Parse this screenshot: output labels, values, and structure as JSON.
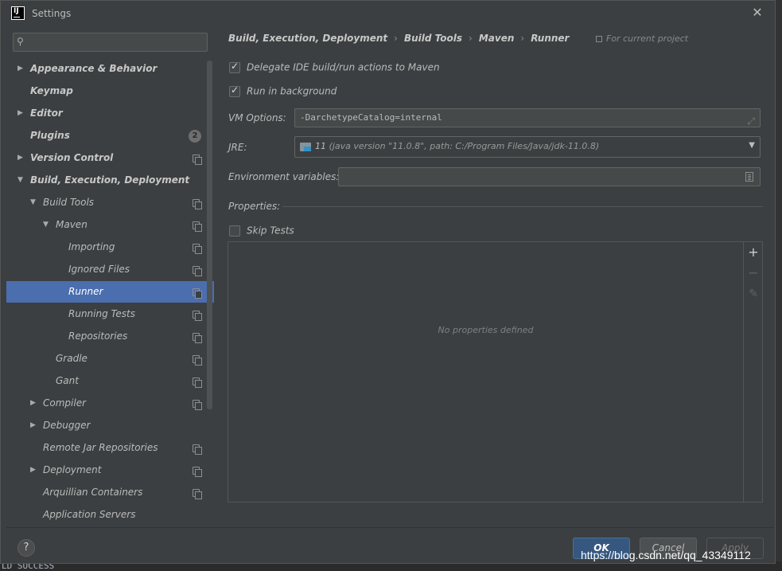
{
  "window": {
    "title": "Settings",
    "app_icon_text": "IJ"
  },
  "search": {
    "placeholder": ""
  },
  "tree": [
    {
      "label": "Appearance & Behavior",
      "bold": true,
      "arrow": "▶",
      "level": 0
    },
    {
      "label": "Keymap",
      "bold": true,
      "arrow": "",
      "level": 0
    },
    {
      "label": "Editor",
      "bold": true,
      "arrow": "▶",
      "level": 0
    },
    {
      "label": "Plugins",
      "bold": true,
      "arrow": "",
      "level": 0,
      "badge": "2"
    },
    {
      "label": "Version Control",
      "bold": true,
      "arrow": "▶",
      "level": 0,
      "copy": true
    },
    {
      "label": "Build, Execution, Deployment",
      "bold": true,
      "arrow": "▼",
      "level": 0
    },
    {
      "label": "Build Tools",
      "bold": false,
      "arrow": "▼",
      "level": 1,
      "copy": true
    },
    {
      "label": "Maven",
      "bold": false,
      "arrow": "▼",
      "level": 2,
      "copy": true
    },
    {
      "label": "Importing",
      "bold": false,
      "arrow": "",
      "level": 3,
      "copy": true
    },
    {
      "label": "Ignored Files",
      "bold": false,
      "arrow": "",
      "level": 3,
      "copy": true
    },
    {
      "label": "Runner",
      "bold": false,
      "arrow": "",
      "level": 3,
      "copy": true,
      "selected": true
    },
    {
      "label": "Running Tests",
      "bold": false,
      "arrow": "",
      "level": 3,
      "copy": true
    },
    {
      "label": "Repositories",
      "bold": false,
      "arrow": "",
      "level": 3,
      "copy": true
    },
    {
      "label": "Gradle",
      "bold": false,
      "arrow": "",
      "level": 2,
      "copy": true
    },
    {
      "label": "Gant",
      "bold": false,
      "arrow": "",
      "level": 2,
      "copy": true
    },
    {
      "label": "Compiler",
      "bold": false,
      "arrow": "▶",
      "level": 1,
      "copy": true
    },
    {
      "label": "Debugger",
      "bold": false,
      "arrow": "▶",
      "level": 1
    },
    {
      "label": "Remote Jar Repositories",
      "bold": false,
      "arrow": "",
      "level": 1,
      "copy": true
    },
    {
      "label": "Deployment",
      "bold": false,
      "arrow": "▶",
      "level": 1,
      "copy": true
    },
    {
      "label": "Arquillian Containers",
      "bold": false,
      "arrow": "",
      "level": 1,
      "copy": true
    },
    {
      "label": "Application Servers",
      "bold": false,
      "arrow": "",
      "level": 1
    }
  ],
  "breadcrumb": {
    "items": [
      "Build, Execution, Deployment",
      "Build Tools",
      "Maven",
      "Runner"
    ],
    "separator": "›",
    "scope": "For current project"
  },
  "runner": {
    "delegate_label": "Delegate IDE build/run actions to Maven",
    "delegate_checked": true,
    "background_label": "Run in background",
    "background_checked": true,
    "vm_options_label": "VM Options:",
    "vm_options_value": "-DarchetypeCatalog=internal",
    "jre_label": "JRE:",
    "jre_value": "11",
    "jre_detail": "(java version \"11.0.8\", path: C:/Program Files/Java/jdk-11.0.8)",
    "env_label": "Environment variables:",
    "env_value": "",
    "properties_label": "Properties:",
    "skip_tests_label": "Skip Tests",
    "skip_tests_checked": false,
    "empty_properties": "No properties defined"
  },
  "toolbar": {
    "add": "+",
    "remove": "−",
    "edit": "✎"
  },
  "buttons": {
    "help": "?",
    "ok": "OK",
    "cancel": "Cancel",
    "apply": "Apply"
  },
  "background": {
    "console_text": "LD SUCCESS"
  },
  "watermark": "https://blog.csdn.net/qq_43349112"
}
